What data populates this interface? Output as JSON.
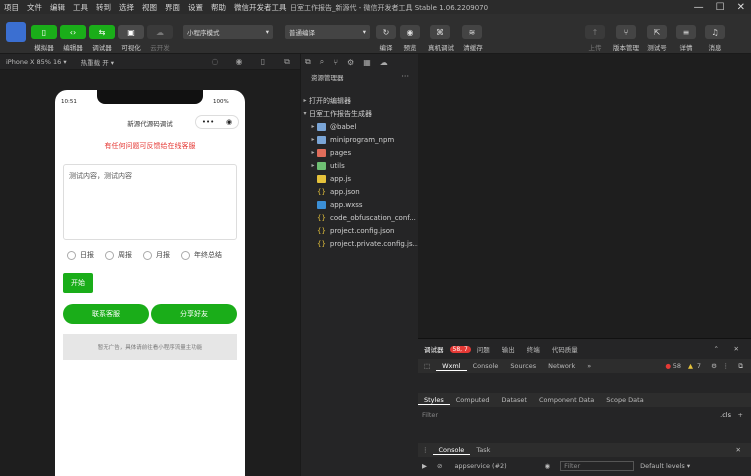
{
  "menu": [
    "项目",
    "文件",
    "编辑",
    "工具",
    "转到",
    "选择",
    "视图",
    "界面",
    "设置",
    "帮助",
    "微信开发者工具"
  ],
  "window_title": "日室工作报告_新源代 - 微信开发者工具 Stable 1.06.2209070",
  "toolbar": {
    "simulator": "模拟器",
    "editor": "编辑器",
    "debugger": "调试器",
    "visual": "可视化",
    "cloud": "云开发",
    "mode_select": "小程序模式",
    "compile_select": "普通编译",
    "compile": "编译",
    "preview": "预览",
    "real_debug": "真机调试",
    "clear_cache": "清缓存",
    "upload": "上传",
    "version": "版本管理",
    "test": "测试号",
    "details": "详情",
    "messages": "消息"
  },
  "device_bar": {
    "device": "iPhone X 85% 16 ▾",
    "hot_reload": "热重载 开 ▾"
  },
  "phone": {
    "time": "10:51",
    "battery": "100%",
    "title": "新源代源码调试",
    "warning": "有任何问题可反馈给在线客服",
    "textarea_text": "测试内容，测试内容",
    "radios": [
      "日报",
      "周报",
      "月报",
      "年终总结"
    ],
    "start_button": "开始",
    "contact_button": "联系客服",
    "share_button": "分享好友",
    "ad_text": "暂无广告，具体请前往看小程序流量主功能"
  },
  "explorer": {
    "header": "资源管理器",
    "open_editors": "打开的编辑器",
    "project": "日室工作报告生成器",
    "items": [
      {
        "name": "@babel",
        "type": "folder"
      },
      {
        "name": "miniprogram_npm",
        "type": "folder"
      },
      {
        "name": "pages",
        "type": "folder-red"
      },
      {
        "name": "utils",
        "type": "folder-green"
      },
      {
        "name": "app.js",
        "type": "js"
      },
      {
        "name": "app.json",
        "type": "json"
      },
      {
        "name": "app.wxss",
        "type": "wxss"
      },
      {
        "name": "code_obfuscation_conf...",
        "type": "json"
      },
      {
        "name": "project.config.json",
        "type": "json"
      },
      {
        "name": "project.private.config.js...",
        "type": "json"
      }
    ]
  },
  "devtools": {
    "tabs": [
      "调试器",
      "问题",
      "输出",
      "终端",
      "代码质量"
    ],
    "badge": "58, 7",
    "panel_tabs": [
      "Wxml",
      "Console",
      "Sources",
      "Network"
    ],
    "errors": "58",
    "warnings": "7",
    "style_tabs": [
      "Styles",
      "Computed",
      "Dataset",
      "Component Data",
      "Scope Data"
    ],
    "filter_placeholder": "Filter",
    "cls": ".cls",
    "console_tabs": [
      "Console",
      "Task"
    ],
    "context": "appservice (#2)",
    "console_filter": "Filter",
    "levels": "Default levels ▾"
  },
  "colors": {
    "accent": "#1aad19",
    "warn": "#e53935"
  }
}
